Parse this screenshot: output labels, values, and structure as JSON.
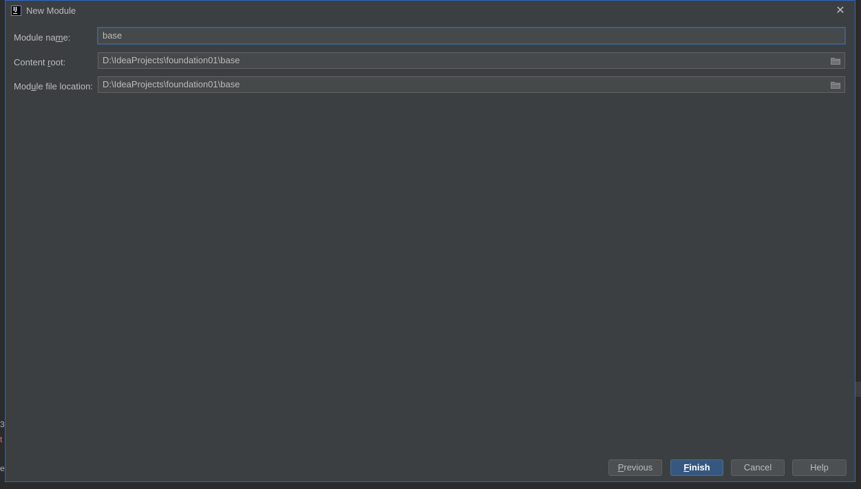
{
  "dialog": {
    "title": "New Module",
    "app_icon_text": "IJ",
    "close_glyph": "✕"
  },
  "background": {
    "fragment_1": "3",
    "fragment_2": "t",
    "fragment_3": "e"
  },
  "form": {
    "module_name": {
      "label_pre": "Module na",
      "label_mnemonic": "m",
      "label_post": "e:",
      "value": "base"
    },
    "content_root": {
      "label_pre": "Content ",
      "label_mnemonic": "r",
      "label_post": "oot:",
      "value": "D:\\IdeaProjects\\foundation01\\base",
      "browse_icon": "folder-icon"
    },
    "module_file_location": {
      "label_pre": "Mod",
      "label_mnemonic": "u",
      "label_post": "le file location:",
      "value": "D:\\IdeaProjects\\foundation01\\base",
      "browse_icon": "folder-icon"
    }
  },
  "buttons": {
    "previous": {
      "mnemonic": "P",
      "rest": "revious"
    },
    "finish": {
      "mnemonic": "F",
      "rest": "inish"
    },
    "cancel": {
      "label": "Cancel"
    },
    "help": {
      "label": "Help"
    }
  },
  "colors": {
    "dialog_bg": "#3c3f41",
    "field_bg": "#45494a",
    "accent_border": "#2f65ca",
    "default_button": "#365880"
  }
}
